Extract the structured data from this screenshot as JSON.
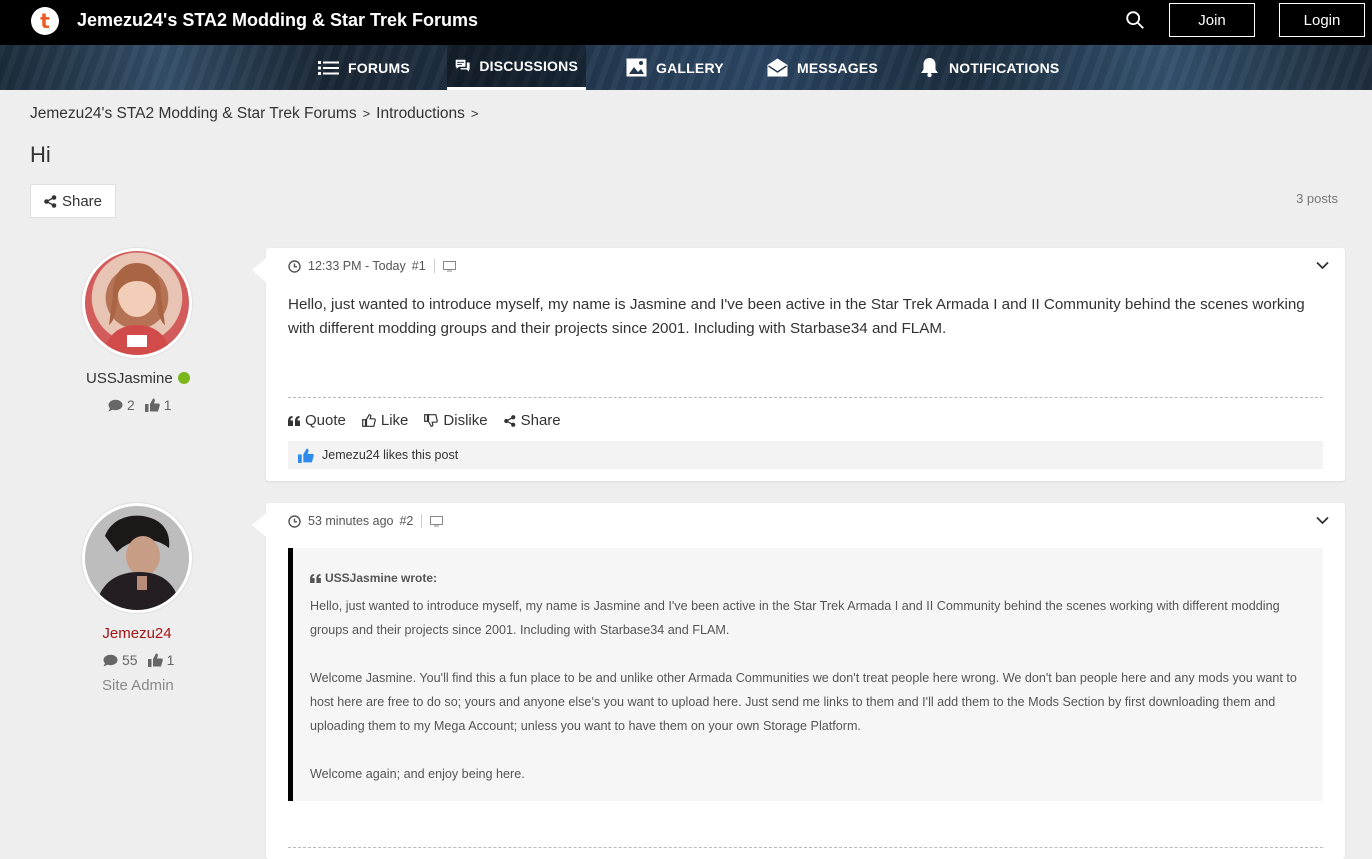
{
  "header": {
    "logo_letter": "t",
    "site_title": "Jemezu24's STA2 Modding & Star Trek Forums",
    "join_label": "Join",
    "login_label": "Login"
  },
  "nav": {
    "items": [
      {
        "label": "FORUMS",
        "icon": "list-icon"
      },
      {
        "label": "DISCUSSIONS",
        "icon": "chat-icon",
        "active": true
      },
      {
        "label": "GALLERY",
        "icon": "image-icon"
      },
      {
        "label": "MESSAGES",
        "icon": "envelope-icon"
      },
      {
        "label": "NOTIFICATIONS",
        "icon": "bell-icon"
      }
    ]
  },
  "breadcrumb": {
    "items": [
      "Jemezu24's STA2 Modding & Star Trek Forums",
      "Introductions"
    ],
    "separator": ">"
  },
  "page": {
    "title": "Hi",
    "share_label": "Share",
    "post_count": "3 posts"
  },
  "posts": [
    {
      "author": "USSJasmine",
      "online": true,
      "author_color": "#333333",
      "stats": {
        "posts": "2",
        "likes": "1"
      },
      "role": "",
      "time": "12:33 PM - Today",
      "number": "#1",
      "body": "Hello, just wanted to introduce myself, my name is Jasmine and I've been active in the Star Trek Armada I and II Community behind the scenes working with different modding groups and their projects since 2001. Including with Starbase34 and FLAM.",
      "actions": {
        "quote": "Quote",
        "like": "Like",
        "dislike": "Dislike",
        "share": "Share"
      },
      "likes_text": "Jemezu24 likes this post"
    },
    {
      "author": "Jemezu24",
      "online": false,
      "author_color": "#a31515",
      "stats": {
        "posts": "55",
        "likes": "1"
      },
      "role": "Site Admin",
      "time": "53 minutes ago",
      "number": "#2",
      "quote_header": "USSJasmine wrote:",
      "paragraphs": [
        "Hello, just wanted to introduce myself, my name is Jasmine and I've been active in the Star Trek Armada I and II Community behind the scenes working with different modding groups and their projects since 2001. Including with Starbase34 and FLAM.",
        "Welcome Jasmine. You'll find this a fun place to be and unlike other Armada Communities we don't treat people here wrong. We don't ban people here and any mods you want to host here are free to do so; yours and anyone else's you want to upload here. Just send me links to them and I'll add them to the Mods Section by first downloading them and uploading them to my Mega Account; unless you want to have them on your own Storage Platform.",
        "Welcome again; and enjoy being here."
      ]
    }
  ],
  "colors": {
    "accent_orange": "#ee5a24",
    "online_green": "#7cb518",
    "admin_red": "#a31515",
    "like_blue": "#2d8ceb"
  }
}
